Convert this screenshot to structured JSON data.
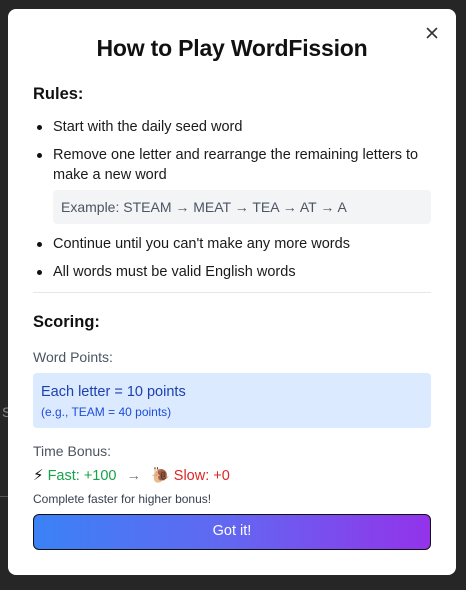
{
  "backdrop": {
    "partial_text": "S"
  },
  "modal": {
    "title": "How to Play WordFission",
    "close_icon": "close-icon"
  },
  "rules": {
    "heading": "Rules:",
    "items": [
      "Start with the daily seed word",
      "Remove one letter and rearrange the remaining letters to make a new word",
      "Continue until you can't make any more words",
      "All words must be valid English words"
    ],
    "example": "Example: STEAM → MEAT → TEA → AT → A"
  },
  "scoring": {
    "heading": "Scoring:",
    "word_points_label": "Word Points:",
    "points_main": "Each letter = 10 points",
    "points_sub": "(e.g., TEAM = 40 points)",
    "time_bonus_label": "Time Bonus:",
    "fast_emoji": "⚡",
    "fast_text": "Fast: +100",
    "arrow": "→",
    "slow_emoji": "🐌",
    "slow_text": "Slow: +0",
    "note": "Complete faster for higher bonus!"
  },
  "button": {
    "label": "Got it!"
  },
  "colors": {
    "accent_start": "#3b82f6",
    "accent_end": "#9333ea",
    "fast": "#16a34a",
    "slow": "#dc2626",
    "points_bg": "#dbeafe",
    "points_text": "#1e40af"
  }
}
